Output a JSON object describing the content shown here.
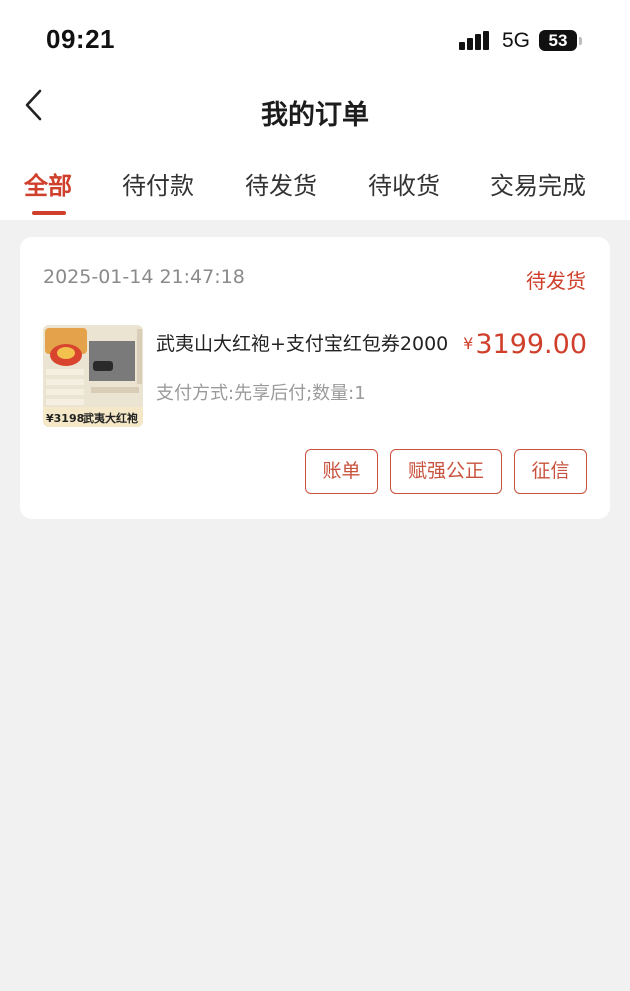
{
  "status_bar": {
    "time": "09:21",
    "network": "5G",
    "battery": "53"
  },
  "header": {
    "title": "我的订单",
    "back_icon": "chevron-left-icon"
  },
  "tabs": [
    {
      "label": "全部",
      "active": true
    },
    {
      "label": "待付款",
      "active": false
    },
    {
      "label": "待发货",
      "active": false
    },
    {
      "label": "待收货",
      "active": false
    },
    {
      "label": "交易完成",
      "active": false
    }
  ],
  "order": {
    "time": "2025-01-14 21:47:18",
    "status": "待发货",
    "product": {
      "name": "武夷山大红袍+支付宝红包券2000",
      "currency": "¥",
      "price": "3199.00",
      "meta": "支付方式:先享后付;数量:1",
      "thumb_price": "¥3198",
      "thumb_caption": "武夷大红袍"
    },
    "actions": [
      "账单",
      "赋强公正",
      "征信"
    ]
  },
  "colors": {
    "accent": "#cf3f2b",
    "button_border": "#c9523e",
    "background": "#f1f1f1"
  }
}
